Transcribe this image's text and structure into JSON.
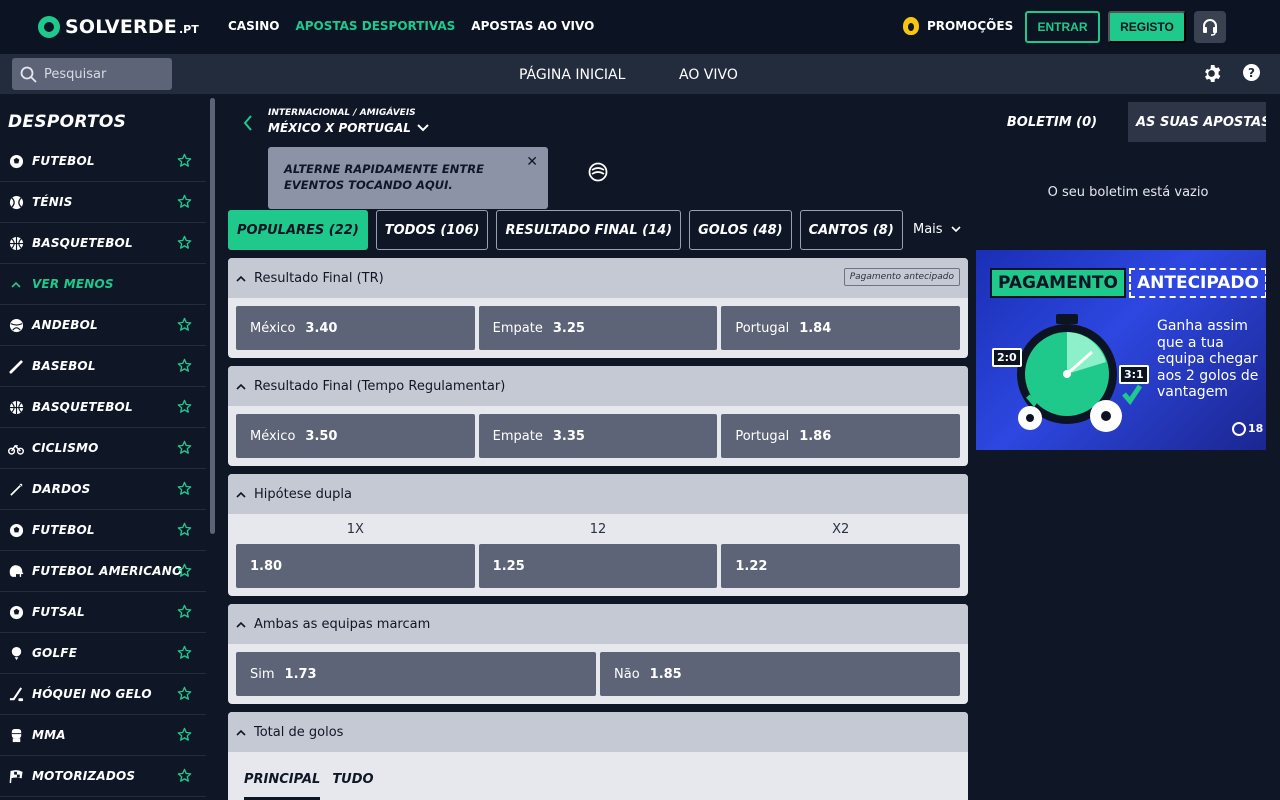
{
  "brand": {
    "name": "SOLVERDE",
    "suffix": ".PT"
  },
  "topnav": [
    {
      "label": "CASINO",
      "active": false
    },
    {
      "label": "APOSTAS DESPORTIVAS",
      "active": true
    },
    {
      "label": "APOSTAS AO VIVO",
      "active": false
    }
  ],
  "header": {
    "promo_label": "PROMOÇÕES",
    "login_label": "ENTRAR",
    "register_label": "REGISTO"
  },
  "subbar": {
    "search_placeholder": "Pesquisar",
    "home_label": "PÁGINA INICIAL",
    "live_label": "AO VIVO"
  },
  "sidebar": {
    "title": "DESPORTOS",
    "top_items": [
      {
        "label": "FUTEBOL",
        "icon": "soccer-ball-icon"
      },
      {
        "label": "TÉNIS",
        "icon": "tennis-ball-icon"
      },
      {
        "label": "BASQUETEBOL",
        "icon": "basketball-icon"
      }
    ],
    "toggle_label": "VER MENOS",
    "items": [
      {
        "label": "ANDEBOL",
        "icon": "handball-icon"
      },
      {
        "label": "BASEBOL",
        "icon": "baseball-bat-icon"
      },
      {
        "label": "BASQUETEBOL",
        "icon": "basketball-icon"
      },
      {
        "label": "CICLISMO",
        "icon": "bicycle-icon"
      },
      {
        "label": "DARDOS",
        "icon": "dart-icon"
      },
      {
        "label": "FUTEBOL",
        "icon": "soccer-ball-icon"
      },
      {
        "label": "FUTEBOL AMERICANO",
        "icon": "football-helmet-icon"
      },
      {
        "label": "FUTSAL",
        "icon": "soccer-ball-icon"
      },
      {
        "label": "GOLFE",
        "icon": "golf-icon"
      },
      {
        "label": "HÓQUEI NO GELO",
        "icon": "hockey-stick-icon"
      },
      {
        "label": "MMA",
        "icon": "mma-glove-icon"
      },
      {
        "label": "MOTORIZADOS",
        "icon": "checkered-flag-icon"
      }
    ]
  },
  "event": {
    "competition": "INTERNACIONAL / AMIGÁVEIS",
    "name": "MÉXICO X PORTUGAL",
    "tooltip": "ALTERNE RAPIDAMENTE ENTRE EVENTOS TOCANDO AQUI.",
    "tooltip_close": "✕"
  },
  "tabs": [
    {
      "label": "POPULARES (22)",
      "active": true
    },
    {
      "label": "TODOS (106)",
      "active": false
    },
    {
      "label": "RESULTADO FINAL (14)",
      "active": false
    },
    {
      "label": "GOLOS (48)",
      "active": false
    },
    {
      "label": "CANTOS (8)",
      "active": false
    }
  ],
  "more_label": "Mais",
  "markets": [
    {
      "title": "Resultado Final (TR)",
      "badge": "Pagamento antecipado",
      "outcomes": [
        {
          "label": "México",
          "odd": "3.40"
        },
        {
          "label": "Empate",
          "odd": "3.25"
        },
        {
          "label": "Portugal",
          "odd": "1.84"
        }
      ]
    },
    {
      "title": "Resultado Final (Tempo Regulamentar)",
      "outcomes": [
        {
          "label": "México",
          "odd": "3.50"
        },
        {
          "label": "Empate",
          "odd": "3.35"
        },
        {
          "label": "Portugal",
          "odd": "1.86"
        }
      ]
    },
    {
      "title": "Hipótese dupla",
      "columns": [
        "1X",
        "12",
        "X2"
      ],
      "outcomes": [
        {
          "label": "",
          "odd": "1.80"
        },
        {
          "label": "",
          "odd": "1.25"
        },
        {
          "label": "",
          "odd": "1.22"
        }
      ]
    },
    {
      "title": "Ambas as equipas marcam",
      "outcomes": [
        {
          "label": "Sim",
          "odd": "1.73"
        },
        {
          "label": "Não",
          "odd": "1.85"
        }
      ]
    },
    {
      "title": "Total de golos",
      "subtabs": [
        "PRINCIPAL",
        "TUDO"
      ]
    }
  ],
  "betslip": {
    "tab_label": "BOLETIM (0)",
    "bets_label": "AS SUAS APOSTAS ...",
    "empty_text": "O seu boletim está vazio"
  },
  "banner": {
    "title_1": "PAGAMENTO",
    "title_2": "ANTECIPADO",
    "text": "Ganha assim que a tua equipa chegar aos 2 golos de vantagem",
    "score_1": "2:0",
    "score_2": "3:1",
    "age": "18"
  },
  "colors": {
    "accent": "#1ec98b",
    "background": "#0f1727",
    "odd_button": "#5d6477",
    "promo": "#f6c60f"
  }
}
